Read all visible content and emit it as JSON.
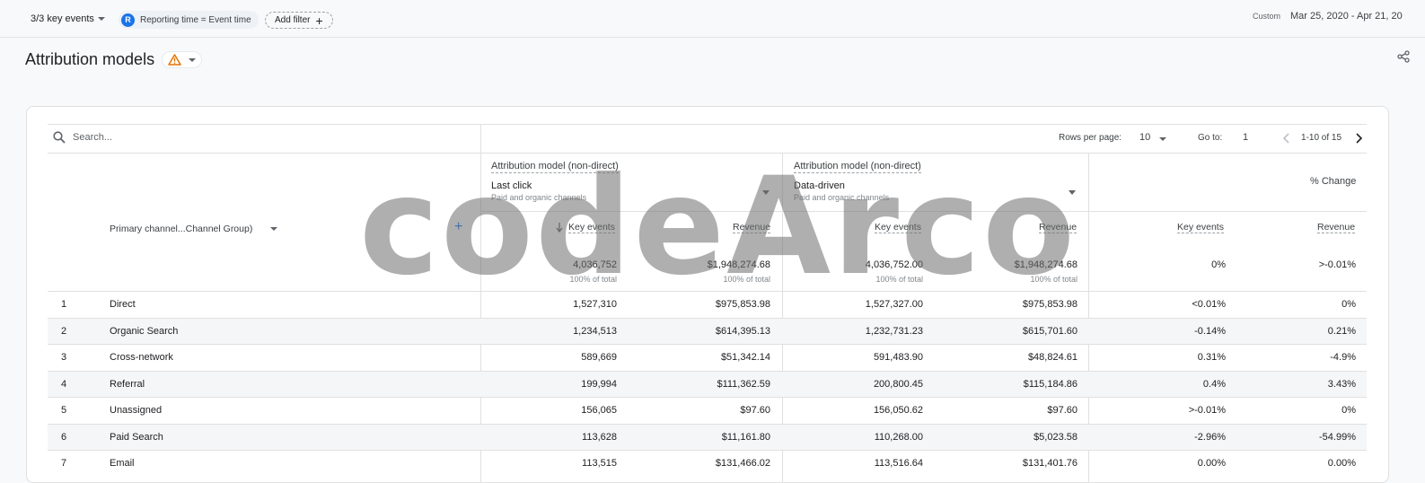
{
  "filters": {
    "key_events": "3/3 key events",
    "chip_avatar": "R",
    "chip_label": "Reporting time = Event time",
    "add_filter": "Add filter",
    "custom_label": "Custom",
    "date_range": "Mar 25, 2020 - Apr 21, 20"
  },
  "page": {
    "title": "Attribution models"
  },
  "toolbar": {
    "search_placeholder": "Search...",
    "rows_per_page_label": "Rows per page:",
    "rows_per_page_value": "10",
    "goto_label": "Go to:",
    "goto_value": "1",
    "range_text": "1-10 of 15"
  },
  "columns": {
    "dimension_label": "Primary channel...Channel Group)",
    "group1": {
      "title": "Attribution model (non-direct)",
      "model": "Last click",
      "sub": "Paid and organic channels"
    },
    "group2": {
      "title": "Attribution model (non-direct)",
      "model": "Data-driven",
      "sub": "Paid and organic channels"
    },
    "group3": {
      "title": "% Change"
    },
    "key_events": "Key events",
    "revenue": "Revenue",
    "key_events2": "Key events",
    "revenue2": "Revenue",
    "key_events3": "Key events",
    "revenue3": "Revenue"
  },
  "totals": {
    "lc_key": "4,036,752",
    "lc_rev": "$1,948,274.68",
    "dd_key": "4,036,752.00",
    "dd_rev": "$1,948,274.68",
    "chg_key": "0%",
    "chg_rev": ">-0.01%",
    "pct_total": "100% of total"
  },
  "rows": [
    {
      "idx": "1",
      "name": "Direct",
      "lc_key": "1,527,310",
      "lc_rev": "$975,853.98",
      "dd_key": "1,527,327.00",
      "dd_rev": "$975,853.98",
      "chg_key": "<0.01%",
      "chg_rev": "0%"
    },
    {
      "idx": "2",
      "name": "Organic Search",
      "lc_key": "1,234,513",
      "lc_rev": "$614,395.13",
      "dd_key": "1,232,731.23",
      "dd_rev": "$615,701.60",
      "chg_key": "-0.14%",
      "chg_rev": "0.21%"
    },
    {
      "idx": "3",
      "name": "Cross-network",
      "lc_key": "589,669",
      "lc_rev": "$51,342.14",
      "dd_key": "591,483.90",
      "dd_rev": "$48,824.61",
      "chg_key": "0.31%",
      "chg_rev": "-4.9%"
    },
    {
      "idx": "4",
      "name": "Referral",
      "lc_key": "199,994",
      "lc_rev": "$111,362.59",
      "dd_key": "200,800.45",
      "dd_rev": "$115,184.86",
      "chg_key": "0.4%",
      "chg_rev": "3.43%"
    },
    {
      "idx": "5",
      "name": "Unassigned",
      "lc_key": "156,065",
      "lc_rev": "$97.60",
      "dd_key": "156,050.62",
      "dd_rev": "$97.60",
      "chg_key": ">-0.01%",
      "chg_rev": "0%"
    },
    {
      "idx": "6",
      "name": "Paid Search",
      "lc_key": "113,628",
      "lc_rev": "$11,161.80",
      "dd_key": "110,268.00",
      "dd_rev": "$5,023.58",
      "chg_key": "-2.96%",
      "chg_rev": "-54.99%"
    },
    {
      "idx": "7",
      "name": "Email",
      "lc_key": "113,515",
      "lc_rev": "$131,466.02",
      "dd_key": "113,516.64",
      "dd_rev": "$131,401.76",
      "chg_key": "0.00%",
      "chg_rev": "0.00%"
    }
  ],
  "watermark": "codeArco",
  "colors": {
    "accent": "#1a73e8",
    "warning": "#e37400",
    "border": "#e0e0e0",
    "alt_row": "#f5f6f7"
  },
  "icons": [
    "chevron-down-icon",
    "plus-icon",
    "warning-icon",
    "share-icon",
    "search-icon",
    "chevron-left-icon",
    "chevron-right-icon",
    "sort-down-icon"
  ]
}
